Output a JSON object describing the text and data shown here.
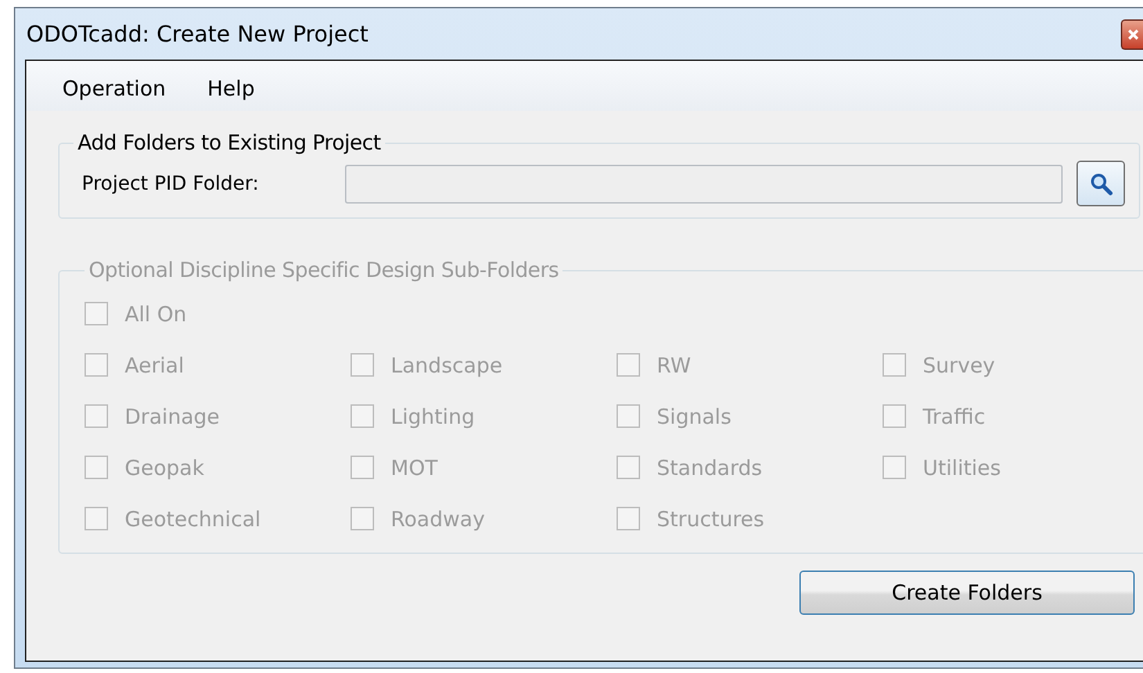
{
  "window": {
    "title": "ODOTcadd: Create New Project"
  },
  "menu": [
    "Operation",
    "Help"
  ],
  "existing_project": {
    "title": "Add Folders to Existing Project",
    "label": "Project PID Folder:"
  },
  "subfolders": {
    "title": "Optional Discipline Specific Design Sub-Folders",
    "disabled": true,
    "all_on": {
      "label": "All On",
      "checked": false
    },
    "items": [
      {
        "label": "Aerial",
        "checked": false
      },
      {
        "label": "Landscape",
        "checked": false
      },
      {
        "label": "RW",
        "checked": false
      },
      {
        "label": "Survey",
        "checked": false
      },
      {
        "label": "Drainage",
        "checked": false
      },
      {
        "label": "Lighting",
        "checked": false
      },
      {
        "label": "Signals",
        "checked": false
      },
      {
        "label": "Traffic",
        "checked": false
      },
      {
        "label": "Geopak",
        "checked": false
      },
      {
        "label": "MOT",
        "checked": false
      },
      {
        "label": "Standards",
        "checked": false
      },
      {
        "label": "Utilities",
        "checked": false
      },
      {
        "label": "Geotechnical",
        "checked": false
      },
      {
        "label": "Roadway",
        "checked": false
      },
      {
        "label": "Structures",
        "checked": false
      }
    ]
  },
  "buttons": [
    "Create Folders"
  ]
}
